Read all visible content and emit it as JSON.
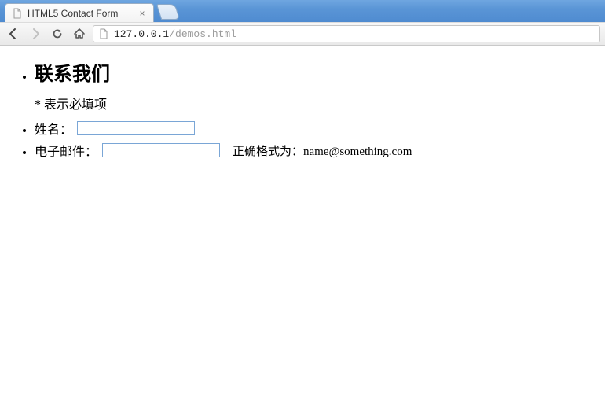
{
  "browser": {
    "tab_title": "HTML5 Contact Form",
    "url_host": "127.0.0.1",
    "url_path": "/demos.html"
  },
  "page": {
    "heading": "联系我们",
    "required_note": "* 表示必填项",
    "fields": {
      "name": {
        "label": "姓名：",
        "value": ""
      },
      "email": {
        "label": "电子邮件：",
        "value": "",
        "hint": "正确格式为：name@something.com"
      }
    }
  }
}
